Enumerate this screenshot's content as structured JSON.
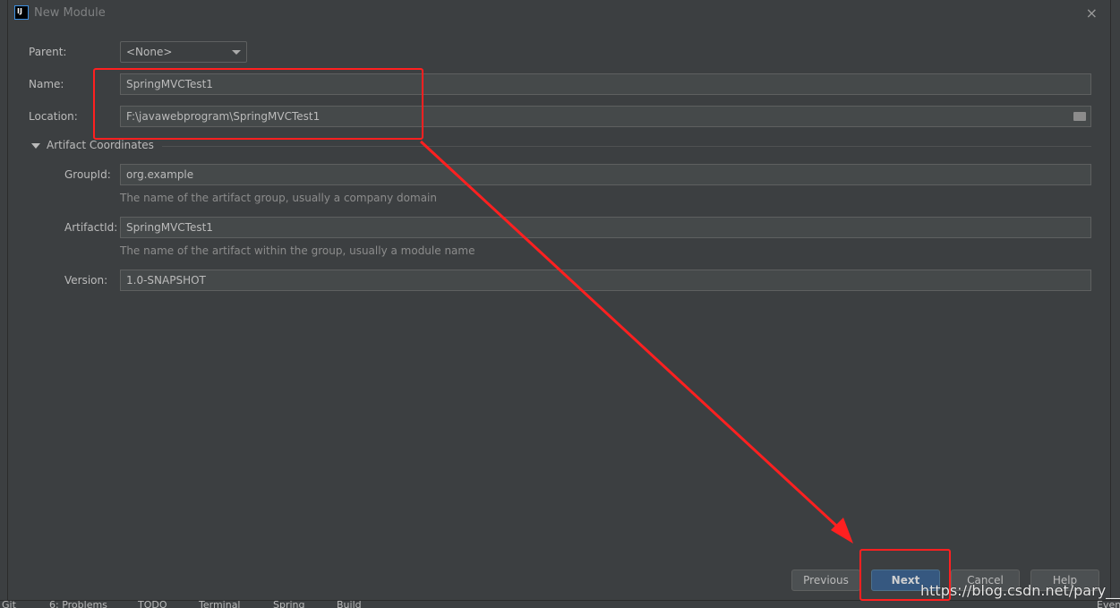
{
  "dialog": {
    "title": "New Module",
    "close": "×"
  },
  "form": {
    "parent_label": "Parent:",
    "parent_value": "<None>",
    "name_label": "Name:",
    "name_value": "SpringMVCTest1",
    "location_label": "Location:",
    "location_value": "F:\\javawebprogram\\SpringMVCTest1"
  },
  "artifact": {
    "section_title": "Artifact Coordinates",
    "group_label": "GroupId:",
    "group_value": "org.example",
    "group_hint": "The name of the artifact group, usually a company domain",
    "artifact_label": "ArtifactId:",
    "artifact_value": "SpringMVCTest1",
    "artifact_hint": "The name of the artifact within the group, usually a module name",
    "version_label": "Version:",
    "version_value": "1.0-SNAPSHOT"
  },
  "buttons": {
    "previous": "Previous",
    "next": "Next",
    "cancel": "Cancel",
    "help": "Help"
  },
  "statusbar": {
    "items": [
      "Git",
      "6: Problems",
      "TODO",
      "Terminal",
      "Spring",
      "Build",
      "Event"
    ]
  },
  "watermark": "https://blog.csdn.net/pary__for",
  "colors": {
    "annotation": "#ff2020",
    "primary_button": "#365880",
    "background": "#3c3f41"
  }
}
